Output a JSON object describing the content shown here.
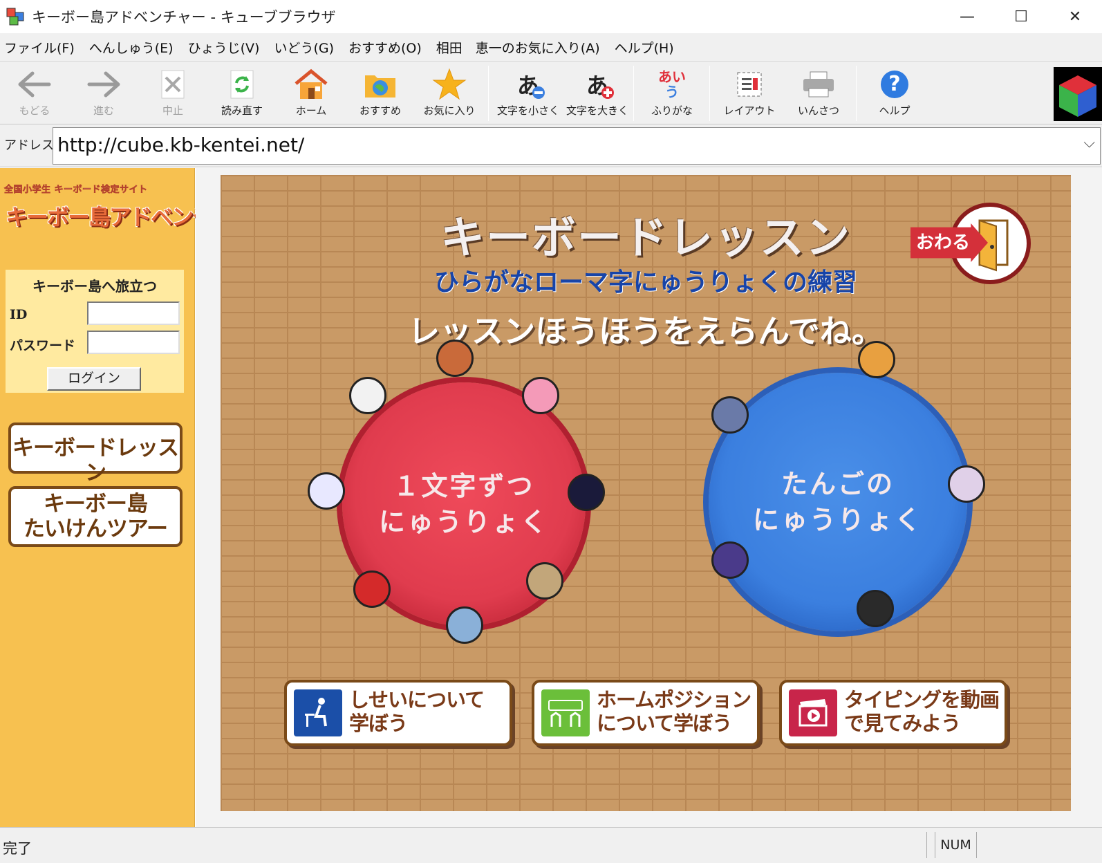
{
  "window": {
    "title": "キーボー島アドベンチャー - キューブブラウザ",
    "minimize": "—",
    "maximize": "☐",
    "close": "✕"
  },
  "menu": [
    {
      "label": "ファイル(F)"
    },
    {
      "label": "へんしゅう(E)"
    },
    {
      "label": "ひょうじ(V)"
    },
    {
      "label": "いどう(G)"
    },
    {
      "label": "おすすめ(O)"
    },
    {
      "label": "相田　恵一のお気に入り(A)"
    },
    {
      "label": "ヘルプ(H)"
    }
  ],
  "toolbar": {
    "back": {
      "label": "もどる",
      "icon": "back-arrow-icon"
    },
    "forward": {
      "label": "進む",
      "icon": "forward-arrow-icon"
    },
    "stop": {
      "label": "中止",
      "icon": "stop-icon"
    },
    "reload": {
      "label": "読み直す",
      "icon": "reload-icon"
    },
    "home": {
      "label": "ホーム",
      "icon": "home-icon"
    },
    "recommend": {
      "label": "おすすめ",
      "icon": "recommend-folder-icon"
    },
    "favorites": {
      "label": "お気に入り",
      "icon": "star-icon"
    },
    "text_smaller": {
      "label": "文字を小さく",
      "icon": "text-smaller-icon",
      "glyph": "あ"
    },
    "text_larger": {
      "label": "文字を大きく",
      "icon": "text-larger-icon",
      "glyph": "あ"
    },
    "furigana": {
      "label": "ふりがな",
      "icon": "furigana-icon",
      "glyph_top": "あい",
      "glyph_bottom": "う"
    },
    "layout": {
      "label": "レイアウト",
      "icon": "layout-icon"
    },
    "print": {
      "label": "いんさつ",
      "icon": "printer-icon"
    },
    "help": {
      "label": "ヘルプ",
      "icon": "help-icon",
      "glyph": "?"
    }
  },
  "address": {
    "label": "アドレス",
    "url": "http://cube.kb-kentei.net/"
  },
  "sidebar": {
    "logo_small": "全国小学生 キーボード検定サイト",
    "logo_big": "キーボー島アドベンチャー",
    "login": {
      "title": "キーボー島へ旅立つ",
      "id_label": "ID",
      "password_label": "パスワード",
      "id_value": "",
      "password_value": "",
      "button": "ログイン"
    },
    "buttons": [
      {
        "label": "キーボードレッスン"
      },
      {
        "label_line1": "キーボー島",
        "label_line2": "たいけんツアー"
      }
    ]
  },
  "main": {
    "title": "キーボードレッスン",
    "subtitle": "ひらがなローマ字にゅうりょくの練習",
    "instruction": "レッスンほうほうをえらんでね。",
    "exit_label": "おわる",
    "option_one": {
      "line1": "１文字ずつ",
      "line2": "にゅうりょく"
    },
    "option_two": {
      "line1": "たんごの",
      "line2": "にゅうりょく"
    },
    "bottom_buttons": [
      {
        "line1": "しせいについて",
        "line2": "学ぼう",
        "icon": "posture-icon",
        "color": "#1b4fa8"
      },
      {
        "line1": "ホームポジション",
        "line2": "について学ぼう",
        "icon": "keyboard-hands-icon",
        "color": "#6bbf3a"
      },
      {
        "line1": "タイピングを動画",
        "line2": "で見てみよう",
        "icon": "video-clapper-icon",
        "color": "#c8254a"
      }
    ]
  },
  "status": {
    "text": "完了",
    "num": "NUM"
  },
  "colors": {
    "sidebar_bg": "#f7c150",
    "brick": "#c99a66",
    "red_circle": "#e03c4e",
    "blue_circle": "#3b7fdf",
    "title_blue": "#1744a8"
  }
}
